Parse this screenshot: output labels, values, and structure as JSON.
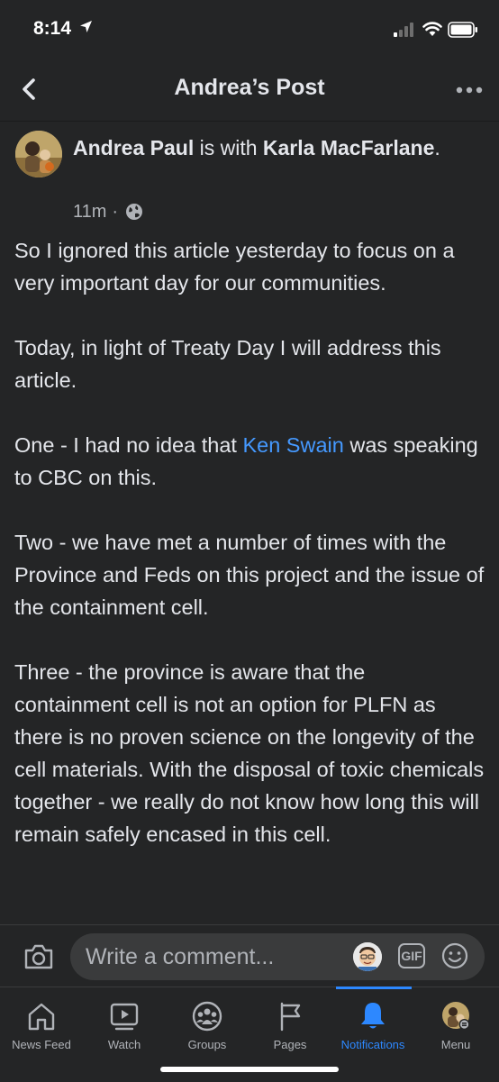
{
  "status_bar": {
    "time": "8:14"
  },
  "nav": {
    "title": "Andrea’s Post"
  },
  "post": {
    "author": "Andrea Paul",
    "with_text": " is with ",
    "tagged": "Karla MacFarlane",
    "period": ".",
    "time": "11m",
    "separator": "·",
    "paragraphs": [
      "So I ignored this article yesterday to focus on a very important day for our communities.",
      "Today, in light of Treaty Day I will address this article.",
      {
        "before": "One - I had no idea that ",
        "link": "Ken Swain",
        "after": " was speaking to CBC on this."
      },
      "Two - we have met a number of times with the Province and Feds on this project and the issue of the containment cell.",
      "Three - the province is aware that the containment cell is not an option for PLFN as there is no proven science on the longevity of the cell materials. With the disposal of toxic chemicals together - we really do not know how long this will remain safely encased in this cell."
    ]
  },
  "comment": {
    "placeholder": "Write a comment...",
    "gif_label": "GIF"
  },
  "tabs": [
    {
      "label": "News Feed",
      "icon": "home-icon"
    },
    {
      "label": "Watch",
      "icon": "watch-icon"
    },
    {
      "label": "Groups",
      "icon": "groups-icon"
    },
    {
      "label": "Pages",
      "icon": "flag-icon"
    },
    {
      "label": "Notifications",
      "icon": "bell-icon",
      "active": true
    },
    {
      "label": "Menu",
      "icon": "profile-menu-icon"
    }
  ],
  "colors": {
    "background": "#242526",
    "text": "#e4e6eb",
    "secondary": "#b0b3b8",
    "accent": "#2d88ff",
    "link": "#4599ff"
  }
}
